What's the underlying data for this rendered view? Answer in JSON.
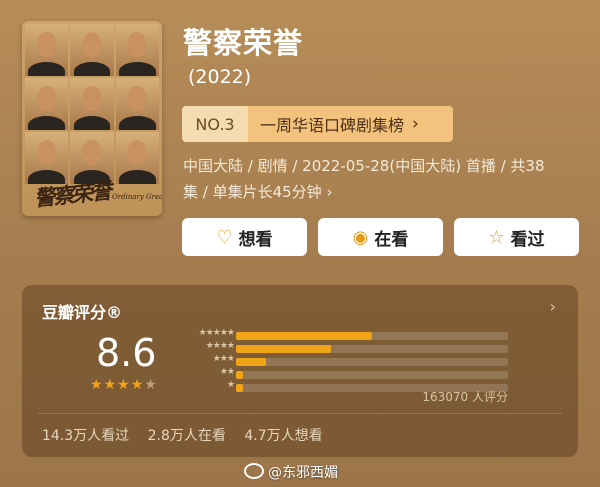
{
  "show": {
    "title": "警察荣誉",
    "year": "(2022)",
    "poster_title": "警察荣誉",
    "poster_subtitle": "Ordinary Greatness"
  },
  "ranking": {
    "rank": "NO.3",
    "list": "一周华语口碑剧集榜",
    "chevron": "›"
  },
  "meta": {
    "line1": "中国大陆 / 剧情 / 2022-05-28(中国大陆) 首播 / 共38",
    "line2": "集 / 单集片长45分钟 ›"
  },
  "actions": [
    {
      "label": "想看",
      "icon": "heart-plus-icon"
    },
    {
      "label": "在看",
      "icon": "target-circle-icon"
    },
    {
      "label": "看过",
      "icon": "star-outline-icon"
    }
  ],
  "rating": {
    "title": "豆瓣评分®",
    "arrow": "›",
    "score": "8.6",
    "stars_filled": 4,
    "stars_partial": 0.3,
    "distribution": [
      {
        "stars": "★★★★★",
        "fraction": 0.5
      },
      {
        "stars": "★★★★",
        "fraction": 0.35
      },
      {
        "stars": "★★★",
        "fraction": 0.11
      },
      {
        "stars": "★★",
        "fraction": 0.025
      },
      {
        "stars": "★",
        "fraction": 0.025
      }
    ],
    "count": "163070 人评分"
  },
  "stats": {
    "watched": "14.3万人看过",
    "watching": "2.8万人在看",
    "want": "4.7万人想看"
  },
  "watermark": "@东邪西媚",
  "colors": {
    "accent": "#f2a417",
    "background": "#a9814f"
  }
}
